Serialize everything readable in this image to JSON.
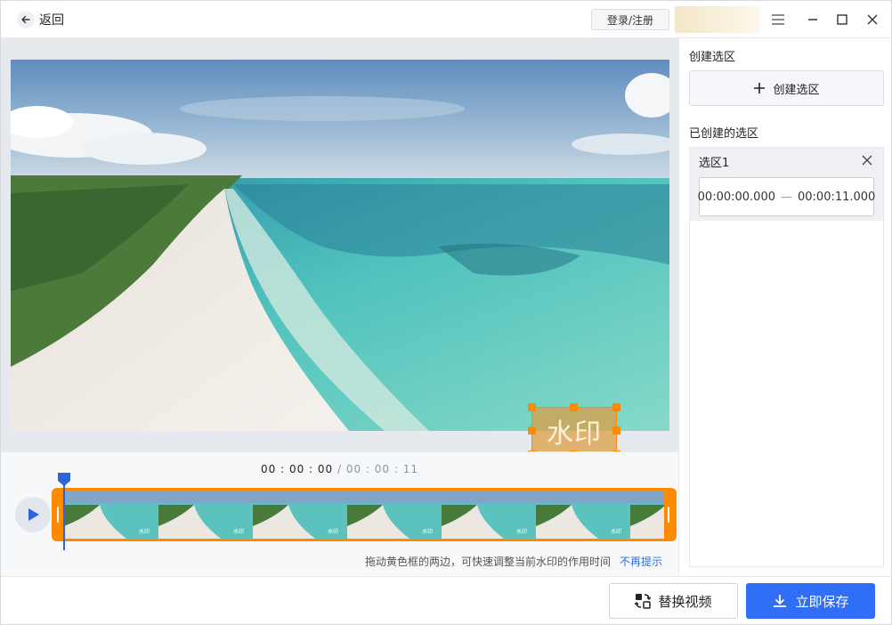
{
  "titlebar": {
    "back_label": "返回",
    "login_label": "登录/注册"
  },
  "preview": {
    "watermark_text": "水印"
  },
  "timeline": {
    "current_time": "00 : 00 : 00",
    "separator": " / ",
    "duration": "00 : 00 : 11",
    "frame_watermark": "水印",
    "hint_text": "拖动黄色框的两边，可快速调整当前水印的作用时间",
    "hide_hint_label": "不再提示"
  },
  "right_panel": {
    "create_section_title": "创建选区",
    "create_button_label": "创建选区",
    "created_section_title": "已创建的选区",
    "selections": [
      {
        "name": "选区1",
        "start": "00:00:00.000",
        "dash": "—",
        "end": "00:00:11.000"
      }
    ]
  },
  "footer": {
    "replace_label": "替换视频",
    "save_label": "立即保存"
  },
  "colors": {
    "accent_blue": "#2f6ef5",
    "selection_orange": "#ff8a00",
    "playhead_blue": "#2c66d6"
  },
  "icons": [
    "back-arrow-icon",
    "menu-icon",
    "minimize-icon",
    "maximize-icon",
    "close-icon",
    "play-icon",
    "plus-icon",
    "replace-icon",
    "download-icon"
  ]
}
